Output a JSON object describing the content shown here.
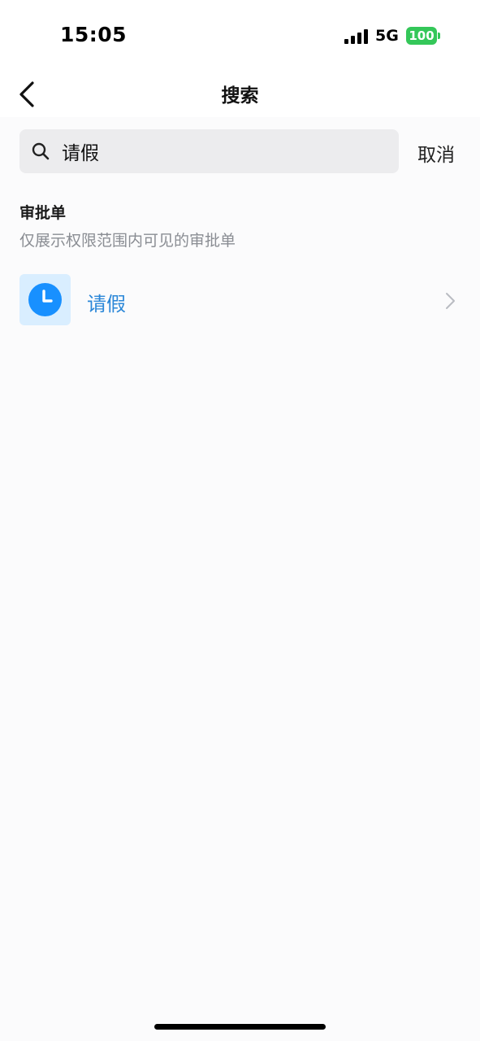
{
  "status_bar": {
    "time": "15:05",
    "network": "5G",
    "battery": "100",
    "battery_color": "#34c759",
    "signal_icon": "signal-bars-icon"
  },
  "nav": {
    "title": "搜索",
    "back_icon": "chevron-left-icon"
  },
  "search": {
    "value": "请假",
    "placeholder": "",
    "icon": "search-icon",
    "cancel_label": "取消"
  },
  "section": {
    "title": "审批单",
    "description": "仅展示权限范围内可见的审批单"
  },
  "results": [
    {
      "label": "请假",
      "icon": "clock-icon",
      "icon_color": "#1890ff",
      "label_color": "#2b87d8"
    }
  ]
}
